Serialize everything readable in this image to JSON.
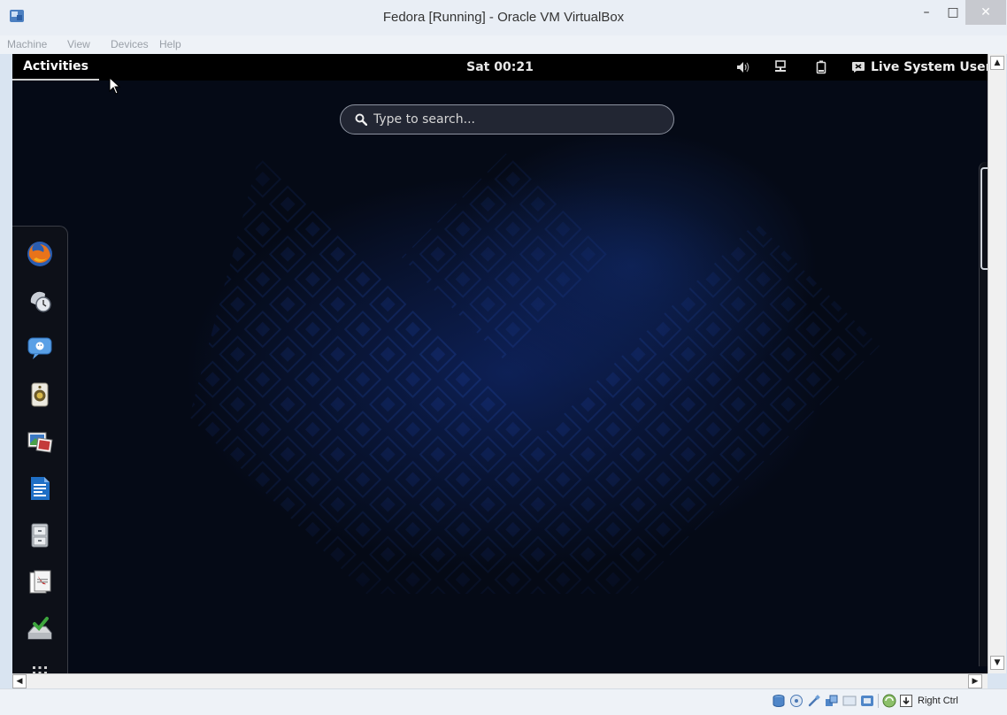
{
  "window": {
    "title": "Fedora [Running] - Oracle VM VirtualBox",
    "controls": {
      "minimize": "–",
      "maximize": "□",
      "close": "✕"
    }
  },
  "menubar": {
    "items": [
      "Machine",
      "View",
      "Devices",
      "Help"
    ]
  },
  "gnome": {
    "activities_label": "Activities",
    "clock": "Sat 00:21",
    "user_label": "Live System User",
    "search_placeholder": "Type to search...",
    "dash_apps": [
      "firefox-icon",
      "clocks-icon",
      "empathy-chat-icon",
      "rhythmbox-speaker-icon",
      "shotwell-photos-icon",
      "writer-document-icon",
      "files-cabinet-icon",
      "document-viewer-icon",
      "install-to-hard-drive-icon",
      "show-applications-icon"
    ]
  },
  "statusbar": {
    "host_key_label": "Right Ctrl"
  },
  "colors": {
    "frame": "#d9e4f1",
    "gnome_bar": "#000000",
    "accent_blue": "#1a3a8a"
  }
}
